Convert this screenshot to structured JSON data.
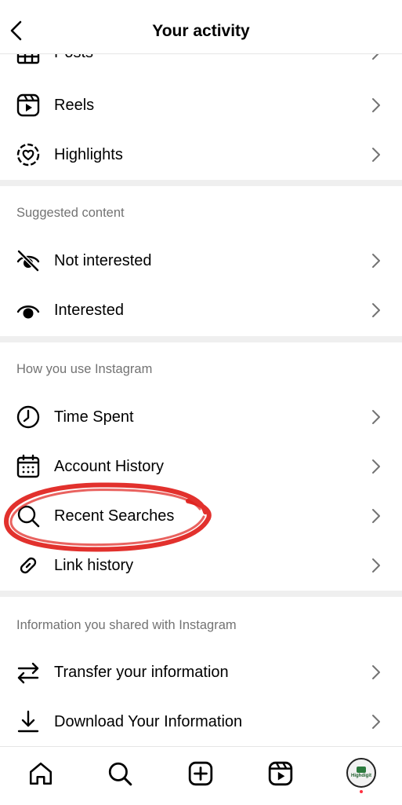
{
  "header": {
    "title": "Your activity"
  },
  "items": {
    "posts": "Posts",
    "reels": "Reels",
    "highlights": "Highlights",
    "not_interested": "Not interested",
    "interested": "Interested",
    "time_spent": "Time Spent",
    "account_history": "Account History",
    "recent_searches": "Recent Searches",
    "link_history": "Link history",
    "transfer_info": "Transfer your information",
    "download_info": "Download Your Information"
  },
  "sections": {
    "suggested": "Suggested content",
    "how_you_use": "How you use Instagram",
    "info_shared": "Information you shared with Instagram"
  },
  "tabbar": {
    "icons": [
      "home-icon",
      "search-icon",
      "create-icon",
      "reels-icon",
      "profile-avatar"
    ],
    "avatar_brand": "Highdigit"
  },
  "annotation": {
    "color": "#e0201b",
    "target": "Recent Searches"
  }
}
